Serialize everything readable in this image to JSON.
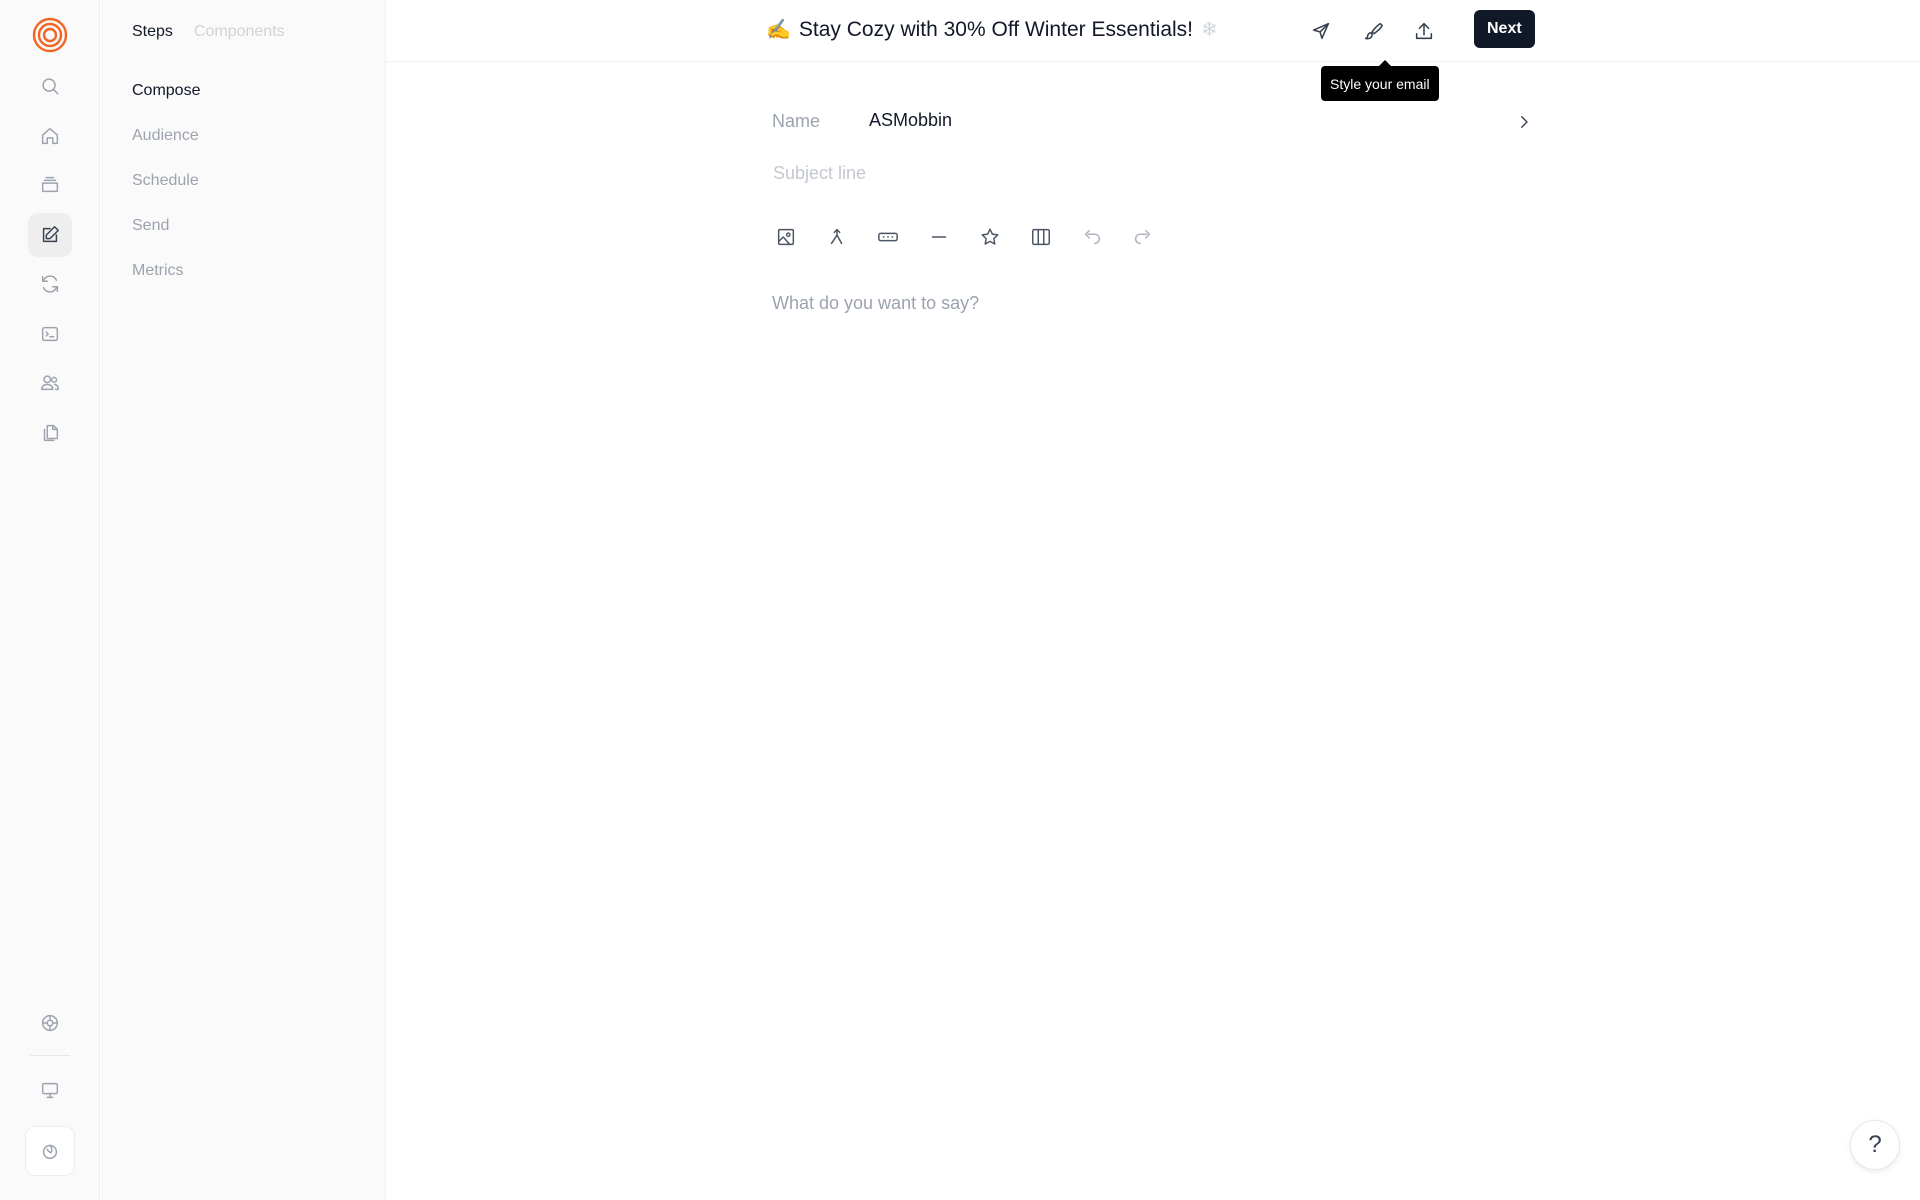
{
  "colors": {
    "brand": "#f26522",
    "primary_button": "#111827",
    "tooltip_bg": "#000000",
    "muted_text": "#9ca3af"
  },
  "rail": {
    "items": [
      {
        "name": "search-icon",
        "active": false
      },
      {
        "name": "home-icon",
        "active": false
      },
      {
        "name": "inbox-icon",
        "active": false
      },
      {
        "name": "compose-icon",
        "active": true
      },
      {
        "name": "refresh-icon",
        "active": false
      },
      {
        "name": "terminal-icon",
        "active": false
      },
      {
        "name": "users-icon",
        "active": false
      },
      {
        "name": "documents-icon",
        "active": false
      }
    ],
    "bottom_items": [
      "settings-icon",
      "monitor-icon",
      "rocket-icon"
    ]
  },
  "panel": {
    "tabs": [
      {
        "label": "Steps",
        "active": true
      },
      {
        "label": "Components",
        "active": false
      }
    ],
    "steps": [
      {
        "label": "Compose",
        "active": true
      },
      {
        "label": "Audience",
        "active": false
      },
      {
        "label": "Schedule",
        "active": false
      },
      {
        "label": "Send",
        "active": false
      },
      {
        "label": "Metrics",
        "active": false
      }
    ]
  },
  "header": {
    "emoji": "✍️",
    "title": "Stay Cozy with 30% Off Winter Essentials!",
    "trailing_emoji": "❄",
    "icons": [
      "send-test-icon",
      "style-brush-icon",
      "export-icon"
    ],
    "next_label": "Next",
    "tooltip": "Style your email"
  },
  "editor": {
    "name_label": "Name",
    "name_value": "ASMobbin",
    "subject_value": "",
    "subject_placeholder": "Subject line",
    "toolbar": [
      "image-icon",
      "merge-icon",
      "button-block-icon",
      "divider-icon",
      "star-icon",
      "columns-icon",
      "undo-icon",
      "redo-icon"
    ],
    "body_value": "",
    "body_placeholder": "What do you want to say?"
  },
  "help": {
    "label": "?"
  }
}
